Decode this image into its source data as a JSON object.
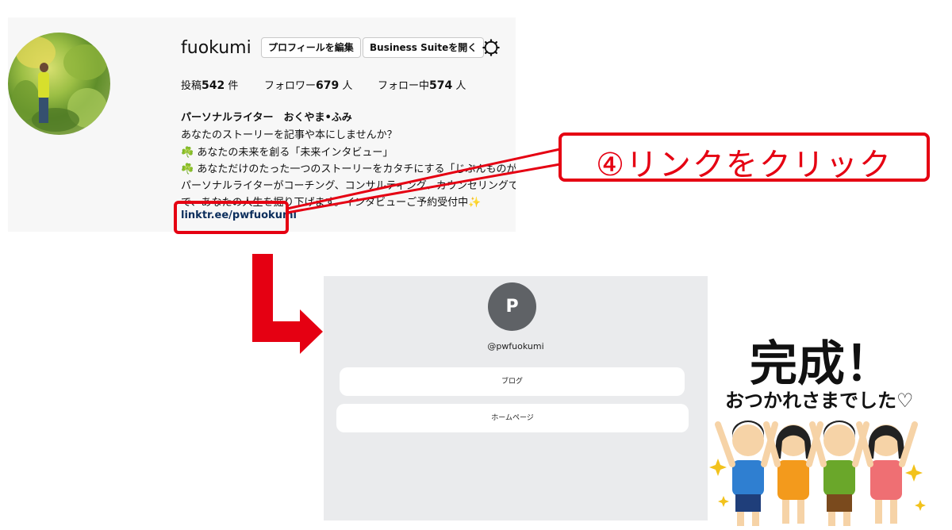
{
  "instagram": {
    "username": "fuokumi",
    "edit_profile_label": "プロフィールを編集",
    "business_suite_label": "Business Suiteを開く",
    "stats": [
      {
        "label": "投稿",
        "value": "542",
        "unit": " 件"
      },
      {
        "label": "フォロワー",
        "value": "679",
        "unit": " 人"
      },
      {
        "label": "フォロー中",
        "value": "574",
        "unit": " 人"
      }
    ],
    "bio": {
      "name": "パーソナルライター　おくやま•ふみ",
      "lines": [
        "あなたのストーリーを記事や本にしませんか？",
        "☘️ あなたの未来を創る「未来インタビュー」",
        "☘️ あなただけのたった一つのストーリーをカタチにする「じぶんものがたり」",
        "パーソナルライターがコーチング、コンサルティング、カウンセリングで",
        "で、あなたの人生を掘り下げます。インタビューご予約受付中✨"
      ],
      "link": "linktr.ee/pwfuokumi"
    }
  },
  "annotation": {
    "callout_text": "④リンクをクリック"
  },
  "linktree": {
    "avatar_letter": "P",
    "handle": "@pwfuokumi",
    "buttons": [
      "ブログ",
      "ホームページ"
    ]
  },
  "completion": {
    "title": "完成！",
    "subtitle": "おつかれさまでした♡"
  },
  "colors": {
    "accent_red": "#e50012",
    "link_blue": "#0c2e5c",
    "linktree_bg": "#eaebed",
    "linktree_avatar": "#5f6266"
  }
}
